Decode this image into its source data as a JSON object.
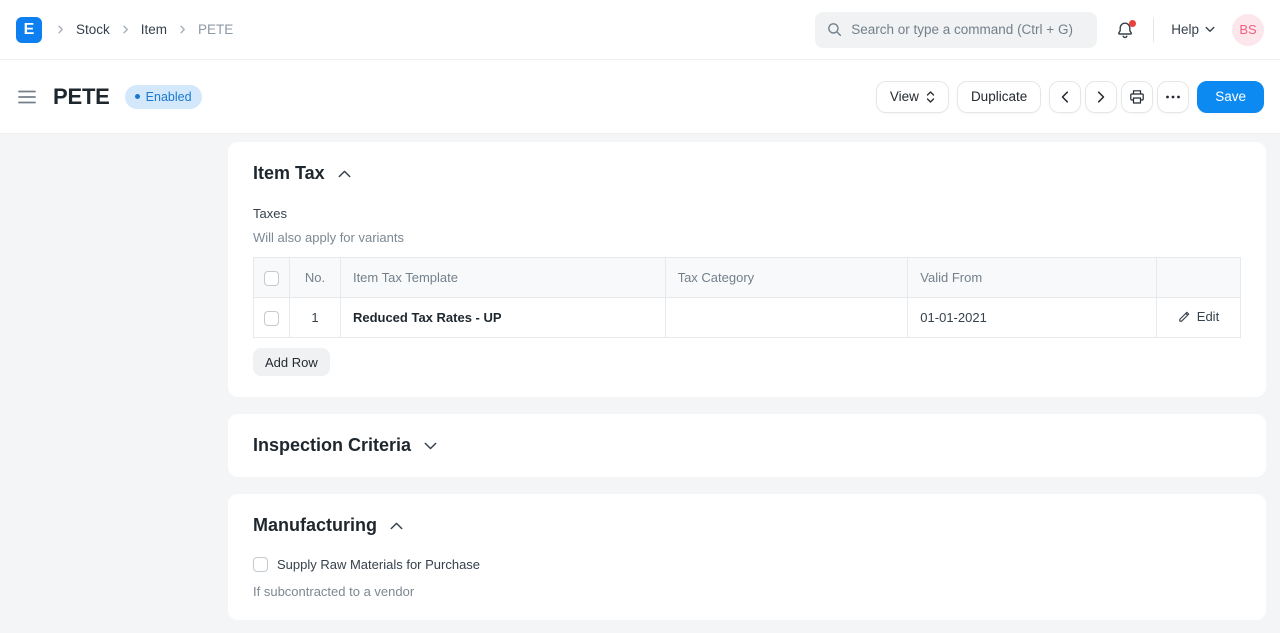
{
  "navbar": {
    "logo_text": "E",
    "breadcrumbs": [
      {
        "label": "Stock"
      },
      {
        "label": "Item"
      },
      {
        "label": "PETE"
      }
    ],
    "search": {
      "placeholder": "Search or type a command (Ctrl + G)"
    },
    "help_label": "Help",
    "avatar_initials": "BS"
  },
  "page_header": {
    "title": "PETE",
    "status_badge": "Enabled",
    "buttons": {
      "view": "View",
      "duplicate": "Duplicate",
      "save": "Save"
    }
  },
  "sections": {
    "item_tax": {
      "title": "Item Tax",
      "field_label": "Taxes",
      "field_description": "Will also apply for variants",
      "table": {
        "headers": {
          "no": "No.",
          "template": "Item Tax Template",
          "category": "Tax Category",
          "valid_from": "Valid From"
        },
        "rows": [
          {
            "no": "1",
            "template": "Reduced Tax Rates - UP",
            "category": "",
            "valid_from": "01-01-2021",
            "action": "Edit"
          }
        ]
      },
      "add_row_label": "Add Row"
    },
    "inspection": {
      "title": "Inspection Criteria"
    },
    "manufacturing": {
      "title": "Manufacturing",
      "checkbox_label": "Supply Raw Materials for Purchase",
      "checkbox_description": "If subcontracted to a vendor",
      "checkbox_checked": false
    }
  },
  "colors": {
    "accent_blue": "#0d8af2",
    "badge_bg": "#d4e8fb",
    "badge_text": "#1878d1",
    "avatar_bg": "#fde7ec",
    "avatar_text": "#f1607e",
    "notification_dot": "#e8413c",
    "page_bg": "#f4f5f6"
  }
}
